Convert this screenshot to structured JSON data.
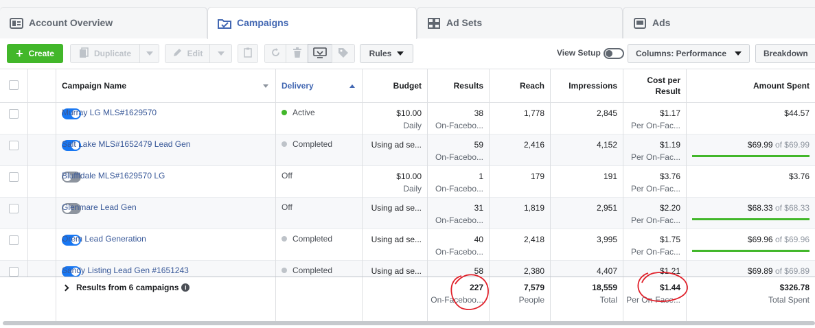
{
  "tabs": [
    {
      "label": "Account Overview",
      "icon": "account-overview-icon"
    },
    {
      "label": "Campaigns",
      "icon": "folder-icon"
    },
    {
      "label": "Ad Sets",
      "icon": "grid-icon"
    },
    {
      "label": "Ads",
      "icon": "ad-icon"
    }
  ],
  "toolbar": {
    "create": "Create",
    "duplicate": "Duplicate",
    "edit": "Edit",
    "rules": "Rules",
    "view_setup": "View Setup",
    "columns": "Columns: Performance",
    "breakdown": "Breakdown"
  },
  "columns": {
    "name": "Campaign Name",
    "delivery": "Delivery",
    "budget": "Budget",
    "results": "Results",
    "reach": "Reach",
    "impressions": "Impressions",
    "cpr_1": "Cost per",
    "cpr_2": "Result",
    "spent": "Amount Spent"
  },
  "rows": [
    {
      "on": true,
      "name": "Murray LG MLS#1629570",
      "status": "active",
      "delivery": "Active",
      "budget": "$10.00",
      "budget_sub": "Daily",
      "results": "38",
      "results_sub": "On-Facebo...",
      "reach": "1,778",
      "impressions": "2,845",
      "cpr": "$1.17",
      "cpr_sub": "Per On-Fac...",
      "spent": "$44.57",
      "spent_of": "",
      "progress": 0
    },
    {
      "on": true,
      "name": "Salt Lake MLS#1652479 Lead Gen",
      "status": "completed",
      "delivery": "Completed",
      "budget": "Using ad se...",
      "budget_sub": "",
      "results": "59",
      "results_sub": "On-Facebo...",
      "reach": "2,416",
      "impressions": "4,152",
      "cpr": "$1.19",
      "cpr_sub": "Per On-Fac...",
      "spent": "$69.99",
      "spent_of": " of $69.99",
      "progress": 1.0
    },
    {
      "on": false,
      "name": "Blufffdale MLS#1629570 LG",
      "status": "off",
      "delivery": "Off",
      "budget": "$10.00",
      "budget_sub": "Daily",
      "results": "1",
      "results_sub": "On-Facebo...",
      "reach": "179",
      "impressions": "191",
      "cpr": "$3.76",
      "cpr_sub": "Per On-Fac...",
      "spent": "$3.76",
      "spent_of": "",
      "progress": 0
    },
    {
      "on": false,
      "name": "Glenmare Lead Gen",
      "status": "off",
      "delivery": "Off",
      "budget": "Using ad se...",
      "budget_sub": "",
      "results": "31",
      "results_sub": "On-Facebo...",
      "reach": "1,819",
      "impressions": "2,951",
      "cpr": "$2.20",
      "cpr_sub": "Per On-Fac...",
      "spent": "$68.33",
      "spent_of": " of $68.33",
      "progress": 1.0
    },
    {
      "on": true,
      "name": "Orem Lead Generation",
      "status": "completed",
      "delivery": "Completed",
      "budget": "Using ad se...",
      "budget_sub": "",
      "results": "40",
      "results_sub": "On-Facebo...",
      "reach": "2,418",
      "impressions": "3,995",
      "cpr": "$1.75",
      "cpr_sub": "Per On-Fac...",
      "spent": "$69.96",
      "spent_of": " of $69.96",
      "progress": 1.0
    },
    {
      "on": true,
      "name": "Sandy Listing Lead Gen #1651243",
      "status": "completed",
      "delivery": "Completed",
      "budget": "Using ad se...",
      "budget_sub": "",
      "results": "58",
      "results_sub": "",
      "reach": "2,380",
      "impressions": "4,407",
      "cpr": "$1.21",
      "cpr_sub": "",
      "spent": "$69.89",
      "spent_of": " of $69.89",
      "progress": 1.0
    }
  ],
  "summary": {
    "label": "Results from 6 campaigns",
    "results": "227",
    "results_sub": "On-Faceboo...",
    "reach": "7,579",
    "reach_sub": "People",
    "impressions": "18,559",
    "impressions_sub": "Total",
    "cpr": "$1.44",
    "cpr_sub": "Per On-Face...",
    "spent": "$326.78",
    "spent_sub": "Total Spent"
  },
  "colors": {
    "accent": "#4267b2",
    "create": "#42b72a",
    "toggle_on": "#1877f2",
    "annotation": "#e0202a"
  }
}
